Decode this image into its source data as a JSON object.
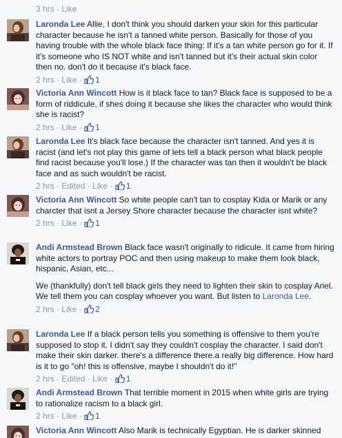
{
  "top_meta": {
    "time": "3 hrs",
    "like_label": "Like"
  },
  "separator": "·",
  "comments": [
    {
      "author": "Laronda Lee",
      "paragraphs": [
        {
          "text": "Allie, I don't think you should darken your skin for this particular character because he isn't a tanned white person. Basically for those of you having trouble with the whole black face thing: If it's a tan white person go for it. If it's someone who IS NOT white and isn't tanned but it's their actual skin color then no. don't do it because it's black face."
        }
      ],
      "time": "2 hrs",
      "edited": "",
      "like_label": "Like",
      "likes": "1"
    },
    {
      "author": "Victoria Ann Wincott",
      "paragraphs": [
        {
          "text": "How is it black face to tan? Black face is supposed to be a form of riddicule, if shes doing it because she likes the character who would think she is racist?"
        }
      ],
      "time": "2 hrs",
      "edited": "",
      "like_label": "Like",
      "likes": "1"
    },
    {
      "author": "Laronda Lee",
      "paragraphs": [
        {
          "text": "It's black face because the character isn't tanned. And yes it is racist (and let's not play this game of lets tell a black person what black people find racist because you'll lose.) If the character was tan then it wouldn't be black face and as such wouldn't be racist."
        }
      ],
      "time": "2 hrs",
      "edited": "Edited",
      "like_label": "Like",
      "likes": "1"
    },
    {
      "author": "Victoria Ann Wincott",
      "paragraphs": [
        {
          "text": "So white people can't tan to cosplay Kida or Marik or any charcter that isnt a Jersey Shore character because the character isnt white?"
        }
      ],
      "time": "2 hrs",
      "edited": "",
      "like_label": "Like",
      "likes": "1"
    },
    {
      "author": "Andi Armstead Brown",
      "paragraphs": [
        {
          "text": "Black face wasn't originally to ridicule. It came from hiring white actors to portray POC and then using makeup to make them look black, hispanic, Asian, etc..."
        },
        {
          "text": "We (thankfully) don't tell black girls they need to lighten their skin to cosplay Ariel. We tell them you can cosplay whoever you want. But listen to",
          "link": "Laronda Lee",
          "after": "."
        }
      ],
      "time": "2 hrs",
      "edited": "",
      "like_label": "Like",
      "likes": "2"
    },
    {
      "author": "Laronda Lee",
      "paragraphs": [
        {
          "text": "If a black person tells you something is offensive to them you're supposed to stop it. I didn't say they couldn't cosplay the character. I said don't make their skin darker. there's a difference there.a really big difference. How hard is it to go \"oh! this is offensive, maybe I shouldn't do it!\""
        }
      ],
      "time": "2 hrs",
      "edited": "Edited",
      "like_label": "Like",
      "likes": "1"
    },
    {
      "author": "Andi Armstead Brown",
      "paragraphs": [
        {
          "text": "That terrible moment in 2015 when white girls are trying to rationalize racism to a black girl."
        }
      ],
      "time": "2 hrs",
      "edited": "",
      "like_label": "Like",
      "likes": "1"
    },
    {
      "author": "Victoria Ann Wincott",
      "paragraphs": [
        {
          "text": "Also Marik is technically Egyptian. He is darker skinned"
        }
      ],
      "time": "",
      "edited": "",
      "like_label": "",
      "likes": ""
    }
  ],
  "colors": {
    "link": "#3b5998",
    "meta": "#9197a3",
    "text": "#141823",
    "background": "#f6f7f9"
  },
  "icons": {
    "like": "thumbs-up-icon"
  }
}
